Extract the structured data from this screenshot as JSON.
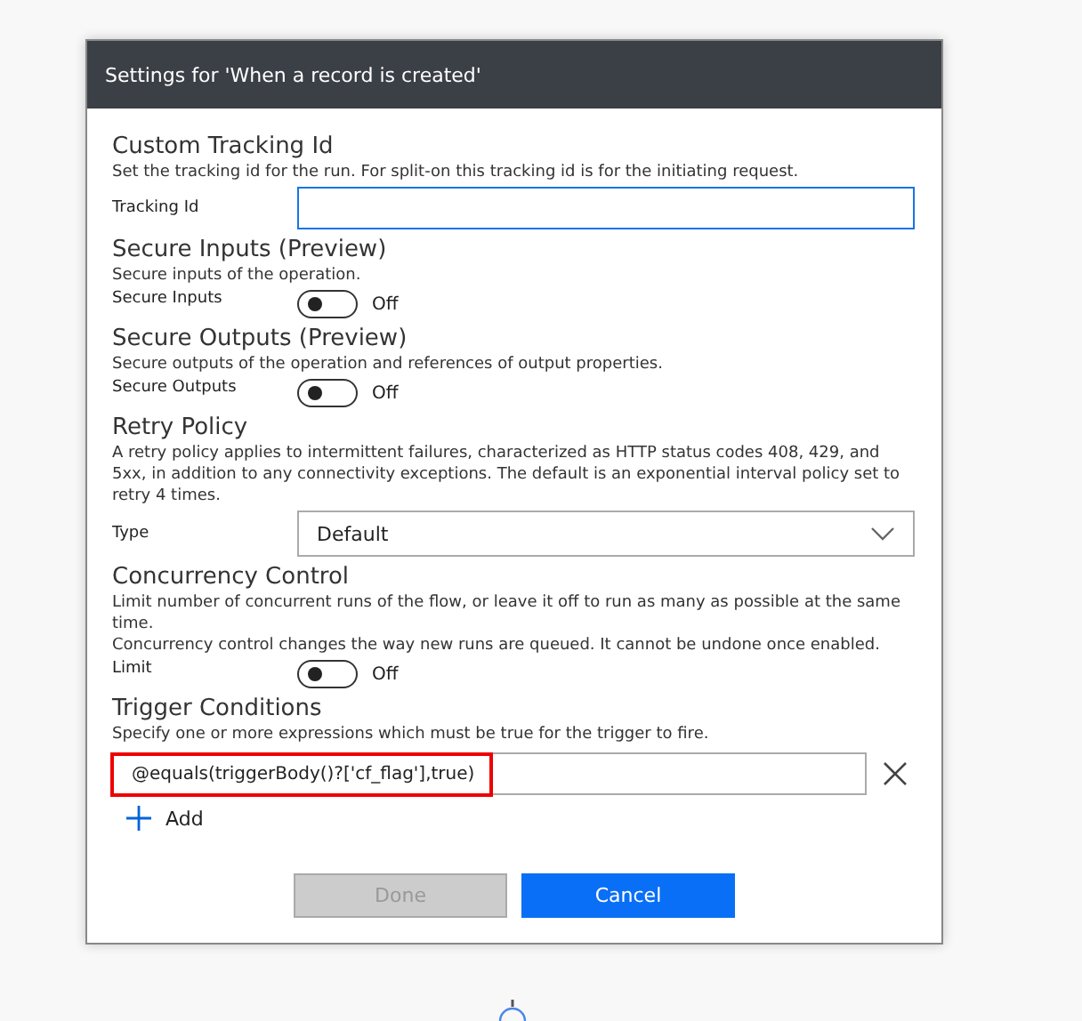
{
  "dialog": {
    "title": "Settings for 'When a record is created'"
  },
  "sections": [
    {
      "kind": "text",
      "title": "Custom Tracking Id",
      "description": [
        "Set the tracking id for the run. For split-on this tracking id is for the initiating request."
      ],
      "label": "Tracking Id",
      "focused": true
    },
    {
      "kind": "toggle",
      "title": "Secure Inputs (Preview)",
      "description": [
        "Secure inputs of the operation."
      ],
      "label": "Secure Inputs",
      "on": false,
      "state_text": "Off"
    },
    {
      "kind": "toggle",
      "title": "Secure Outputs (Preview)",
      "description": [
        "Secure outputs of the operation and references of output properties."
      ],
      "label": "Secure Outputs",
      "on": false,
      "state_text": "Off"
    },
    {
      "kind": "select",
      "title": "Retry Policy",
      "description": [
        "A retry policy applies to intermittent failures, characterized as HTTP status codes 408, 429, and 5xx, in addition to any connectivity exceptions. The default is an exponential interval policy set to retry 4 times."
      ],
      "label": "Type",
      "value": "Default"
    },
    {
      "kind": "toggle",
      "title": "Concurrency Control",
      "description": [
        "Limit number of concurrent runs of the flow, or leave it off to run as many as possible at the same time.",
        "Concurrency control changes the way new runs are queued. It cannot be undone once enabled."
      ],
      "label": "Limit",
      "on": false,
      "state_text": "Off"
    },
    {
      "kind": "conditions",
      "title": "Trigger Conditions",
      "description": [
        "Specify one or more expressions which must be true for the trigger to fire."
      ],
      "conditions": [
        {
          "value": "@equals(triggerBody()?['cf_flag'],true)",
          "highlighted": true
        }
      ],
      "add_label": "Add"
    }
  ],
  "buttons": [
    {
      "label": "Done",
      "kind": "secondary",
      "disabled": true
    },
    {
      "label": "Cancel",
      "kind": "primary",
      "disabled": false
    }
  ]
}
